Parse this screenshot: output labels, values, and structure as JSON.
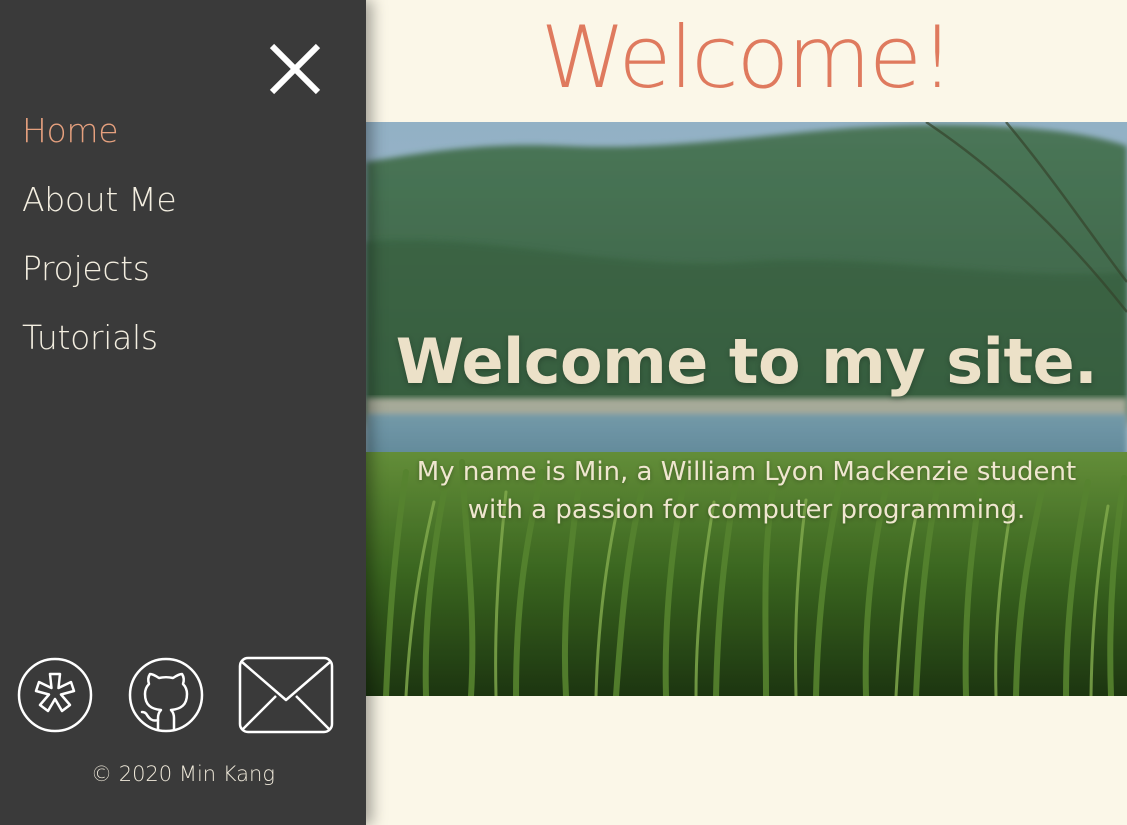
{
  "page": {
    "title": "Welcome!"
  },
  "sidebar": {
    "close_icon": "close-icon",
    "items": [
      {
        "label": "Home",
        "active": true
      },
      {
        "label": "About Me",
        "active": false
      },
      {
        "label": "Projects",
        "active": false
      },
      {
        "label": "Tutorials",
        "active": false
      }
    ],
    "socials": [
      {
        "icon": "asterisk-circle-icon"
      },
      {
        "icon": "github-icon"
      },
      {
        "icon": "mail-icon"
      }
    ],
    "copyright": "© 2020 Min Kang"
  },
  "hero": {
    "heading": "Welcome to my site.",
    "text": "My name is Min, a William Lyon Mackenzie student with a passion for computer programming."
  },
  "colors": {
    "sidebar_bg": "#3a3a3a",
    "accent": "#df7a5e",
    "active_nav": "#e5a07e",
    "page_bg": "#fbf7e8"
  }
}
